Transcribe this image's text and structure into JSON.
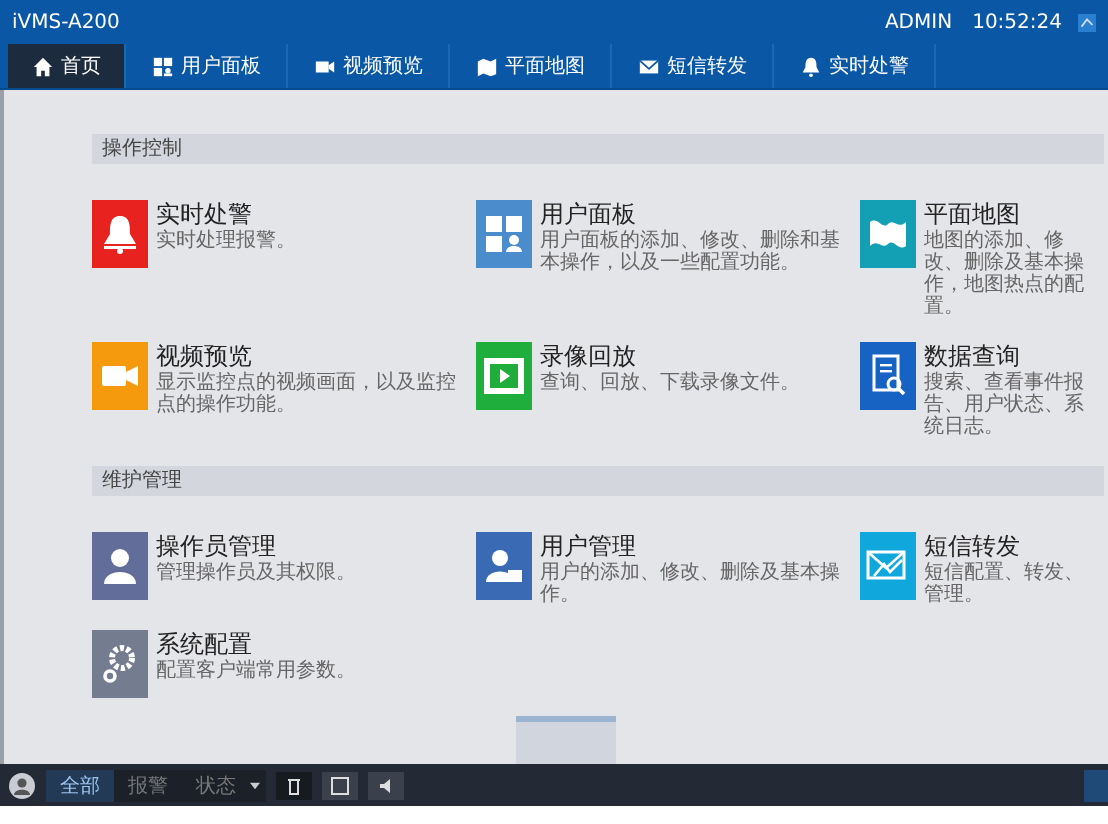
{
  "header": {
    "title": "iVMS-A200",
    "user": "ADMIN",
    "time": "10:52:24"
  },
  "nav_tabs": [
    {
      "label": "首页",
      "kind": "home",
      "selected": true
    },
    {
      "label": "用户面板",
      "kind": "panel",
      "selected": false
    },
    {
      "label": "视频预览",
      "kind": "camera",
      "selected": false
    },
    {
      "label": "平面地图",
      "kind": "map",
      "selected": false
    },
    {
      "label": "短信转发",
      "kind": "mail",
      "selected": false
    },
    {
      "label": "实时处警",
      "kind": "bell",
      "selected": false
    }
  ],
  "sections": [
    {
      "title": "操作控制",
      "items": [
        {
          "title": "实时处警",
          "description": "实时处理报警。",
          "kind": "bell",
          "color": "#e8221f"
        },
        {
          "title": "用户面板",
          "description": "用户面板的添加、修改、删除和基本操作，以及一些配置功能。",
          "kind": "panel",
          "color": "#4a8ccc"
        },
        {
          "title": "平面地图",
          "description": "地图的添加、修改、删除及基本操作，地图热点的配置。",
          "kind": "map",
          "color": "#14a0b4"
        },
        {
          "title": "视频预览",
          "description": "显示监控点的视频画面，以及监控点的操作功能。",
          "kind": "camera",
          "color": "#f59a0c"
        },
        {
          "title": "录像回放",
          "description": "查询、回放、下载录像文件。",
          "kind": "film",
          "color": "#1fae3c"
        },
        {
          "title": "数据查询",
          "description": "搜索、查看事件报告、用户状态、系统日志。",
          "kind": "search",
          "color": "#1663c4"
        }
      ]
    },
    {
      "title": "维护管理",
      "items": [
        {
          "title": "操作员管理",
          "description": "管理操作员及其权限。",
          "kind": "person",
          "color": "#626d99"
        },
        {
          "title": "用户管理",
          "description": "用户的添加、修改、删除及基本操作。",
          "kind": "card",
          "color": "#3a6ab4"
        },
        {
          "title": "短信转发",
          "description": "短信配置、转发、管理。",
          "kind": "mail",
          "color": "#10a8dc"
        },
        {
          "title": "系统配置",
          "description": "配置客户端常用参数。",
          "kind": "gear",
          "color": "#747c90"
        }
      ]
    }
  ],
  "bottom_bar": {
    "filters": [
      {
        "label": "全部",
        "selected": true
      },
      {
        "label": "报警",
        "selected": false
      },
      {
        "label": "状态",
        "selected": false
      }
    ]
  }
}
